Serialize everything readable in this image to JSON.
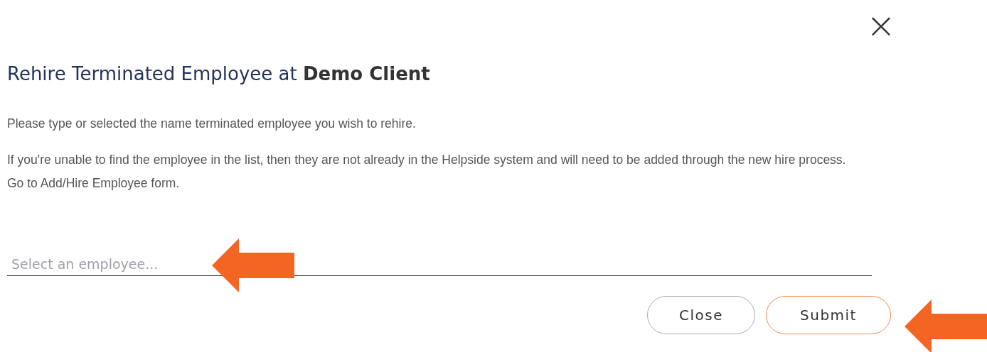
{
  "dialog": {
    "close_icon": "×",
    "title": "Rehire Terminated Employee at **Demo Client**",
    "paragraphs": [
      "Please type or selected the name terminated employee you wish to rehire.",
      "If you're unable to find the employee in the list, then they are not already in the Helpside system and will need to be added through the new hire process. Go to Add/Hire Employee form."
    ],
    "employee_field": {
      "placeholder": "Select an employee..."
    },
    "buttons": [
      {
        "label": "Close",
        "kind": "secondary"
      },
      {
        "label": "Submit",
        "kind": "primary"
      }
    ]
  }
}
